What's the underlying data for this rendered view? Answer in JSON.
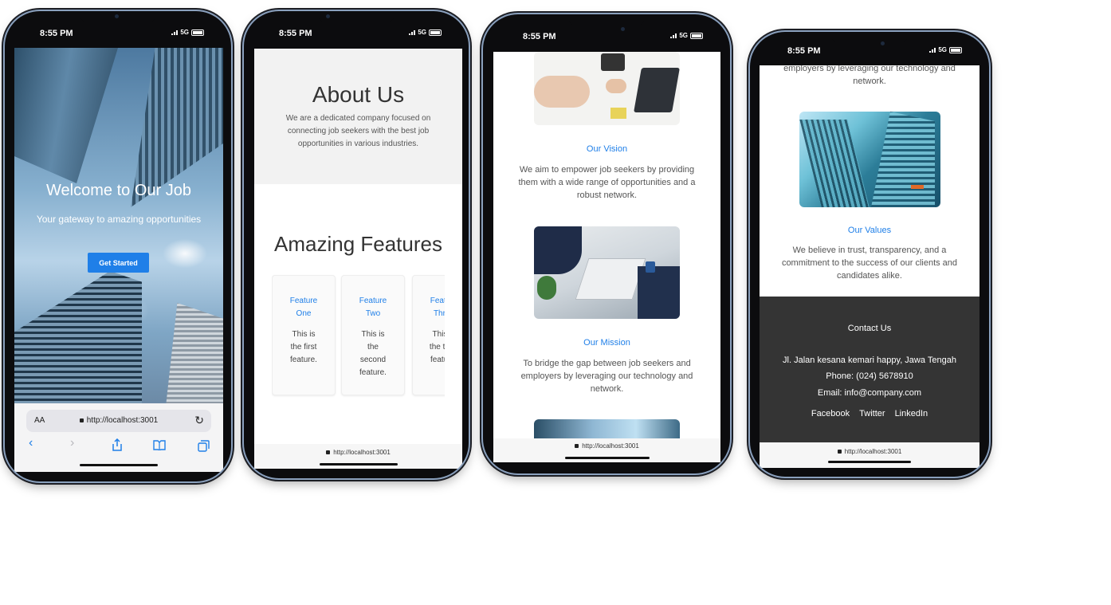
{
  "status": {
    "time": "8:55 PM",
    "network": "5G"
  },
  "phone1": {
    "hero_title": "Welcome to Our Job",
    "hero_subtitle": "Your gateway to amazing opportunities",
    "cta_label": "Get Started",
    "address_aa": "AA",
    "address_url": "http://localhost:3001"
  },
  "phone2": {
    "about_title": "About Us",
    "about_text": "We are a dedicated company focused on connecting job seekers with the best job opportunities in various industries.",
    "features_title": "Amazing Features",
    "features": [
      {
        "title": "Feature One",
        "desc": "This is the first feature."
      },
      {
        "title": "Feature Two",
        "desc": "This is the second feature."
      },
      {
        "title": "Feature Three",
        "desc": "This is the third feature."
      }
    ],
    "url": "http://localhost:3001"
  },
  "phone3": {
    "vision_title": "Our Vision",
    "vision_text": "We aim to empower job seekers by providing them with a wide range of opportunities and a robust network.",
    "mission_title": "Our Mission",
    "mission_text": "To bridge the gap between job seekers and employers by leveraging our technology and network.",
    "url": "http://localhost:3001"
  },
  "phone4": {
    "mission_tail": "employers by leveraging our technology and network.",
    "values_title": "Our Values",
    "values_text": "We believe in trust, transparency, and a commitment to the success of our clients and candidates alike.",
    "contact_title": "Contact Us",
    "address": "Jl. Jalan kesana kemari happy, Jawa Tengah",
    "phone": "Phone: (024) 5678910",
    "email": "Email: info@company.com",
    "links": [
      "Facebook",
      "Twitter",
      "LinkedIn"
    ],
    "url": "http://localhost:3001"
  },
  "colors": {
    "accent": "#1f7fe8",
    "footer_bg": "#343434",
    "about_bg": "#f2f2f2"
  }
}
